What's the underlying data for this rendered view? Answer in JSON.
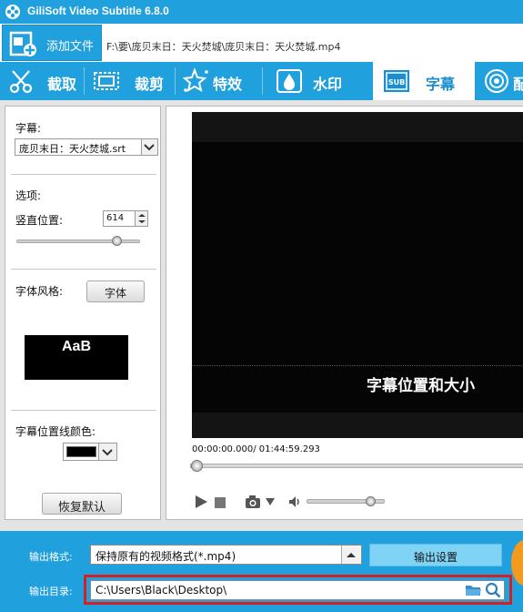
{
  "app": {
    "title": "GiliSoft Video Subtitle 6.8.0"
  },
  "file_bar": {
    "add_label": "添加文件",
    "file_path": "F:\\要\\庞贝末日：天火焚城\\庞贝末日：天火焚城.mp4"
  },
  "tabs": [
    {
      "label": "截取",
      "icon": "film-cut-icon"
    },
    {
      "label": "裁剪",
      "icon": "crop-icon"
    },
    {
      "label": "特效",
      "icon": "sparkle-icon"
    },
    {
      "label": "水印",
      "icon": "watermark-drop-icon"
    },
    {
      "label": "字幕",
      "icon": "subtitle-icon",
      "active": true
    },
    {
      "label": "配",
      "icon": "audio-icon"
    }
  ],
  "left_panel": {
    "subtitle_label": "字幕:",
    "subtitle_file": "庞贝末日：天火焚城.srt",
    "options_label": "选项:",
    "vpos_label": "竖直位置:",
    "vpos_value": "614",
    "vpos_slider_fraction": 0.83,
    "font_style_label": "字体风格:",
    "font_button": "字体",
    "font_preview_text": "AaB",
    "line_color_label": "字幕位置线颜色:",
    "line_color": "#000000",
    "reset_button": "恢复默认"
  },
  "player": {
    "subtitle_preview_text": "字幕位置和大小",
    "time_current": "00:00:00.000",
    "time_total": "/ 01:44:59.293",
    "progress_fraction": 0.0,
    "volume_fraction": 0.85
  },
  "output": {
    "format_label": "输出格式:",
    "format_value": "保持原有的视频格式(*.mp4)",
    "settings_button": "输出设置",
    "dir_label": "输出目录:",
    "dir_value": "C:\\Users\\Black\\Desktop\\"
  },
  "colors": {
    "accent": "#21a0de",
    "highlight_border": "#d42020"
  }
}
